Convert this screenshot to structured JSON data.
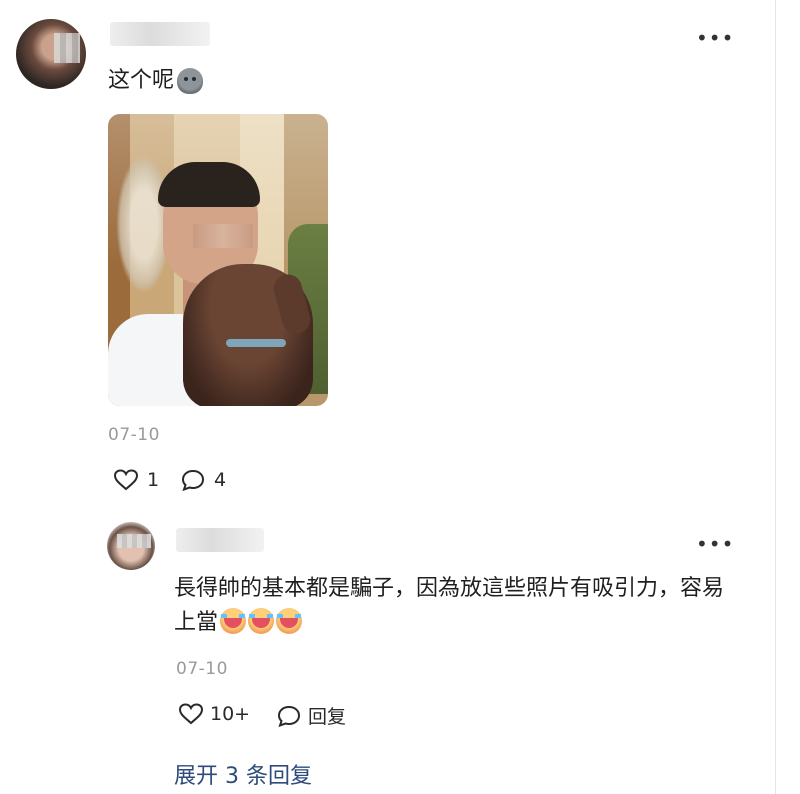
{
  "comment": {
    "author_name": "",
    "text": "这个呢",
    "emoji": "ghost-emoji",
    "date": "07-10",
    "likes": "1",
    "replies_count": "4"
  },
  "reply": {
    "author_name": "",
    "text": "長得帥的基本都是騙子，因為放這些照片有吸引力，容易上當",
    "emojis": [
      "crying-laughing-emoji",
      "crying-laughing-emoji",
      "crying-laughing-emoji"
    ],
    "date": "07-10",
    "likes": "10+",
    "reply_label": "回复"
  },
  "expand_label": "展开 3 条回复",
  "colors": {
    "link": "#2d4b7b",
    "meta": "#9a9a9a"
  }
}
